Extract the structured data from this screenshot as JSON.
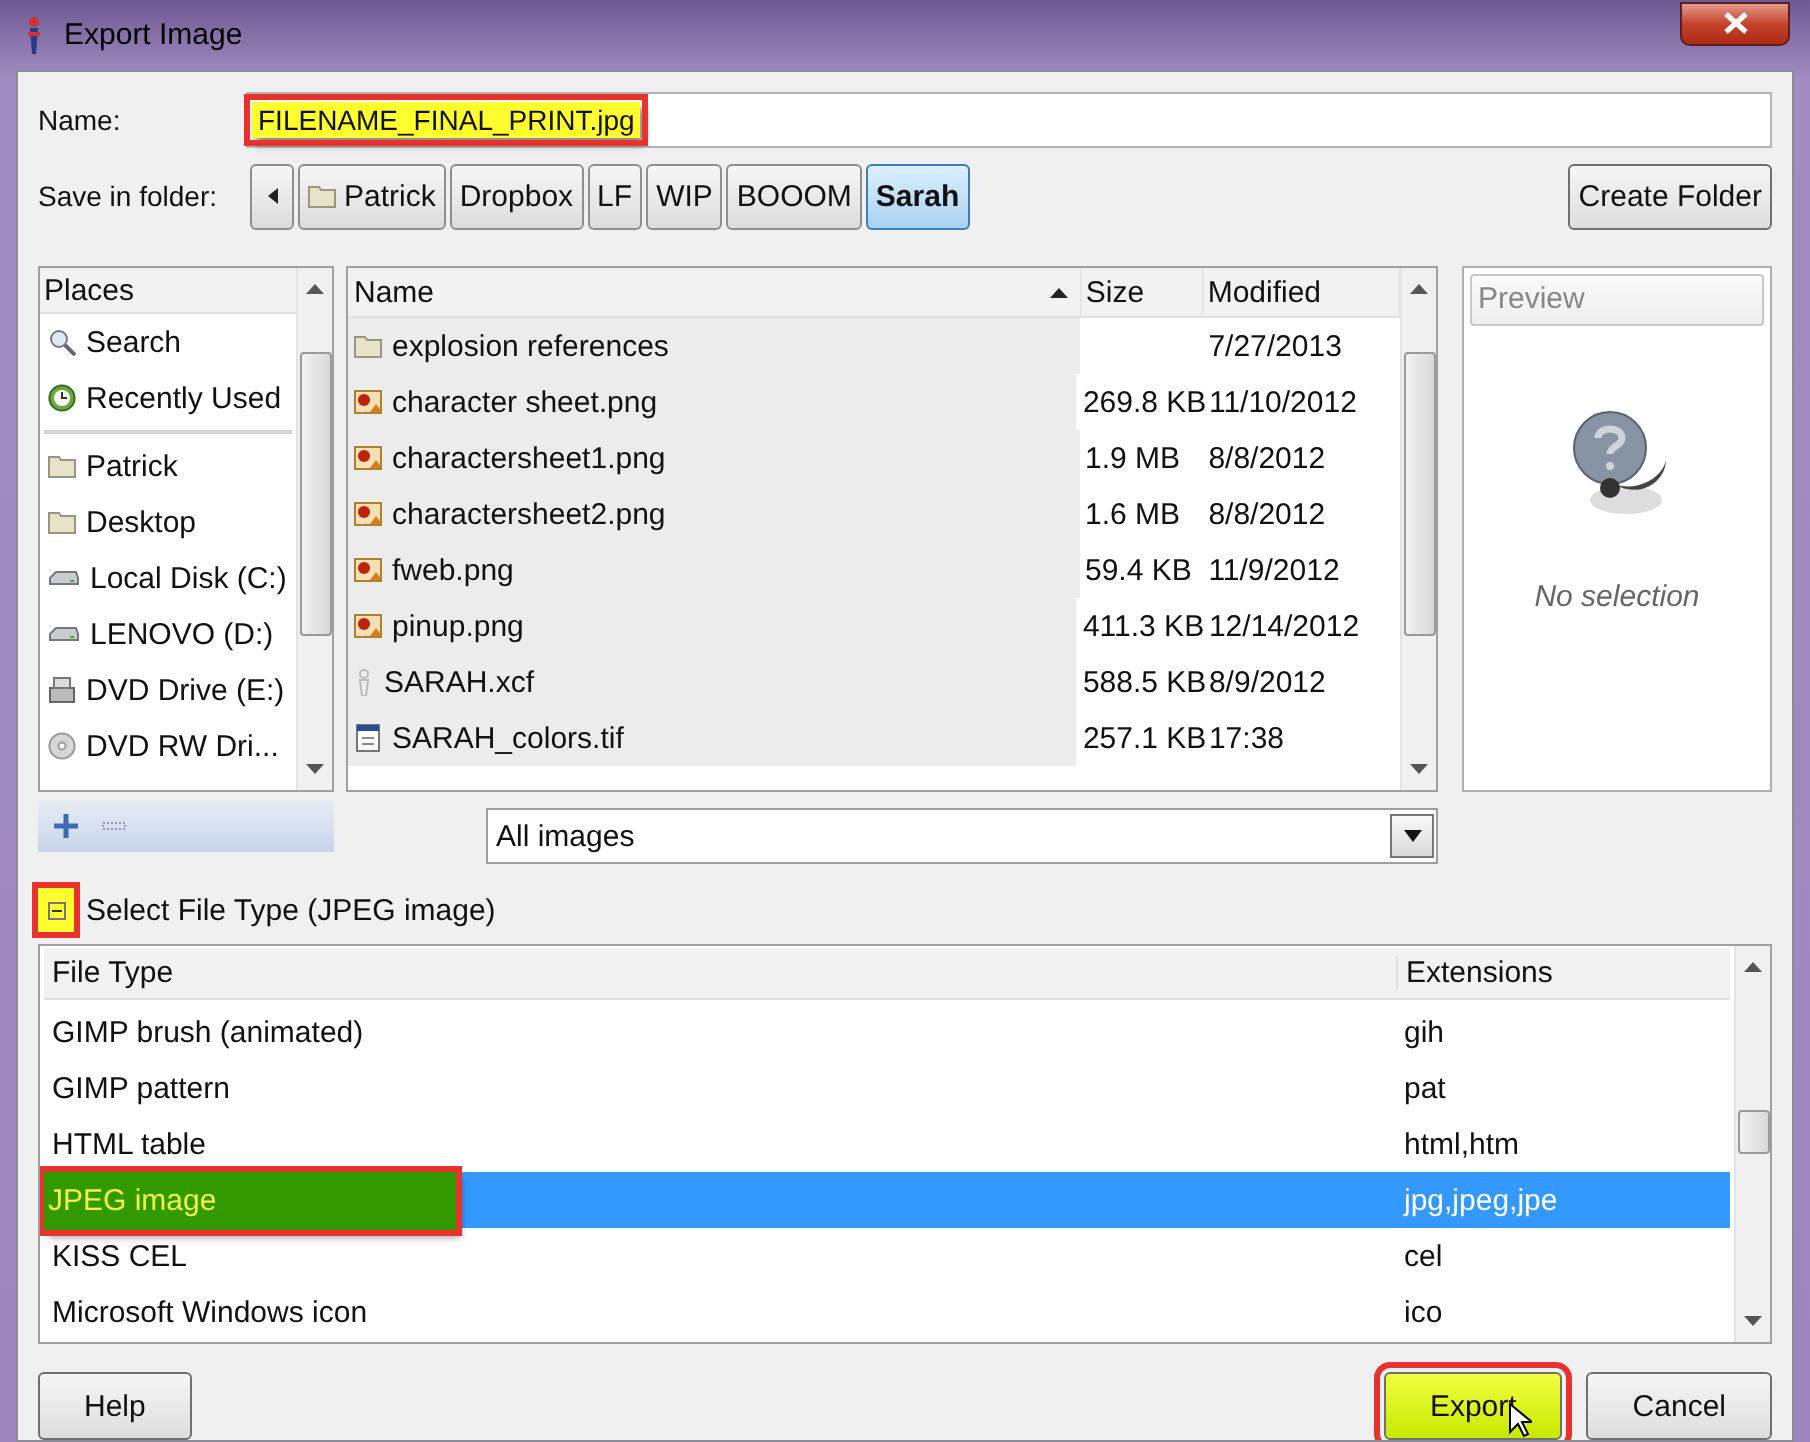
{
  "window": {
    "title": "Export Image"
  },
  "name_field": {
    "label": "Name:",
    "value": "FILENAME_FINAL_PRINT.jpg",
    "highlighted": true
  },
  "save_in_folder": {
    "label": "Save in folder:",
    "path": [
      {
        "label": "Patrick",
        "kind": "folder",
        "selected": false
      },
      {
        "label": "Dropbox",
        "kind": "plain",
        "selected": false
      },
      {
        "label": "LF",
        "kind": "plain",
        "selected": false
      },
      {
        "label": "WIP",
        "kind": "plain",
        "selected": false
      },
      {
        "label": "BOOOM",
        "kind": "plain",
        "selected": false
      },
      {
        "label": "Sarah",
        "kind": "plain",
        "selected": true
      }
    ]
  },
  "create_folder_button": {
    "label": "Create Folder"
  },
  "places": {
    "header": "Places",
    "items": [
      {
        "label": "Search",
        "kind": "search",
        "separator_before": false
      },
      {
        "label": "Recently Used",
        "kind": "recent",
        "separator_before": false
      },
      {
        "label": "Patrick",
        "kind": "folder",
        "separator_before": true
      },
      {
        "label": "Desktop",
        "kind": "folder",
        "separator_before": false
      },
      {
        "label": "Local Disk (C:)",
        "kind": "drive",
        "separator_before": false
      },
      {
        "label": "LENOVO (D:)",
        "kind": "drive",
        "separator_before": false
      },
      {
        "label": "DVD Drive (E:)",
        "kind": "dvd",
        "separator_before": false
      },
      {
        "label": "DVD RW Dri...",
        "kind": "disc",
        "separator_before": false
      }
    ]
  },
  "files": {
    "columns": [
      {
        "label": "Name",
        "sorted": true
      },
      {
        "label": "Size",
        "sorted": false
      },
      {
        "label": "Modified",
        "sorted": false
      }
    ],
    "rows": [
      {
        "name": "explosion references",
        "size": "",
        "modified": "7/27/2013",
        "kind": "folder"
      },
      {
        "name": "character sheet.png",
        "size": "269.8 KB",
        "modified": "11/10/2012",
        "kind": "image"
      },
      {
        "name": "charactersheet1.png",
        "size": "1.9 MB",
        "modified": "8/8/2012",
        "kind": "image"
      },
      {
        "name": "charactersheet2.png",
        "size": "1.6 MB",
        "modified": "8/8/2012",
        "kind": "image"
      },
      {
        "name": "fweb.png",
        "size": "59.4 KB",
        "modified": "11/9/2012",
        "kind": "image"
      },
      {
        "name": "pinup.png",
        "size": "411.3 KB",
        "modified": "12/14/2012",
        "kind": "image"
      },
      {
        "name": "SARAH.xcf",
        "size": "588.5 KB",
        "modified": "8/9/2012",
        "kind": "xcf"
      },
      {
        "name": "SARAH_colors.tif",
        "size": "257.1 KB",
        "modified": "17:38",
        "kind": "tif"
      }
    ]
  },
  "preview": {
    "label": "Preview",
    "message": "No selection"
  },
  "filter": {
    "value": "All images"
  },
  "file_type": {
    "label": "Select File Type (JPEG image)",
    "expanded": true,
    "highlighted": true,
    "columns": [
      "File Type",
      "Extensions"
    ],
    "rows": [
      {
        "type": "GIMP brush (animated)",
        "extensions": "gih",
        "selected": false,
        "highlighted": false
      },
      {
        "type": "GIMP pattern",
        "extensions": "pat",
        "selected": false,
        "highlighted": false
      },
      {
        "type": "HTML table",
        "extensions": "html,htm",
        "selected": false,
        "highlighted": false
      },
      {
        "type": "JPEG image",
        "extensions": "jpg,jpeg,jpe",
        "selected": true,
        "highlighted": true
      },
      {
        "type": "KISS CEL",
        "extensions": "cel",
        "selected": false,
        "highlighted": false
      },
      {
        "type": "Microsoft Windows icon",
        "extensions": "ico",
        "selected": false,
        "highlighted": false
      }
    ]
  },
  "buttons": [
    {
      "label": "Help",
      "highlighted": false
    },
    {
      "label": "Export",
      "highlighted": true
    },
    {
      "label": "Cancel",
      "highlighted": false
    }
  ]
}
